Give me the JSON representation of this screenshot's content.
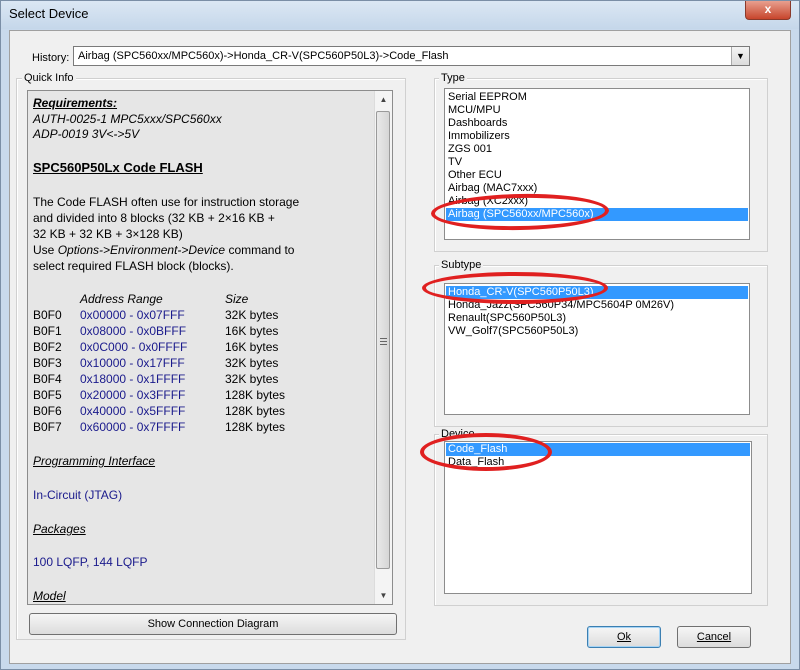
{
  "window": {
    "title": "Select Device",
    "close_label": "x"
  },
  "history": {
    "label": "History:",
    "value": "Airbag (SPC560xx/MPC560x)->Honda_CR-V(SPC560P50L3)->Code_Flash"
  },
  "quick_info": {
    "group_label": "Quick Info",
    "requirements_heading": "Requirements:",
    "req_line1": "AUTH-0025-1 MPC5xxx/SPC560xx",
    "req_line2": "ADP-0019 3V<->5V",
    "title": "SPC560P50Lx Code FLASH",
    "desc_line1": "The Code FLASH often use for instruction storage",
    "desc_line2": "and divided into 8 blocks (32 KB + 2×16 KB +",
    "desc_line3": "32 KB + 32 KB + 3×128 KB)",
    "desc_line4_pre": "Use ",
    "desc_line4_em": "Options->Environment->Device",
    "desc_line4_post": " command to",
    "desc_line5": "select required FLASH block (blocks).",
    "address_range_header": "Address Range",
    "size_header": "Size",
    "blocks": [
      {
        "name": "B0F0",
        "range": "0x00000 - 0x07FFF",
        "size": "32K bytes"
      },
      {
        "name": "B0F1",
        "range": "0x08000 - 0x0BFFF",
        "size": "16K bytes"
      },
      {
        "name": "B0F2",
        "range": "0x0C000 - 0x0FFFF",
        "size": "16K bytes"
      },
      {
        "name": "B0F3",
        "range": "0x10000 - 0x17FFF",
        "size": "32K bytes"
      },
      {
        "name": "B0F4",
        "range": "0x18000 - 0x1FFFF",
        "size": "32K bytes"
      },
      {
        "name": "B0F5",
        "range": "0x20000 - 0x3FFFF",
        "size": "128K bytes"
      },
      {
        "name": "B0F6",
        "range": "0x40000 - 0x5FFFF",
        "size": "128K bytes"
      },
      {
        "name": "B0F7",
        "range": "0x60000 - 0x7FFFF",
        "size": "128K bytes"
      }
    ],
    "programming_interface_heading": "Programming Interface",
    "programming_interface_value": "In-Circuit (JTAG)",
    "packages_heading": "Packages",
    "packages_value": "100 LQFP, 144 LQFP",
    "model_heading": "Model"
  },
  "show_connection_diagram_label": "Show Connection Diagram",
  "type": {
    "group_label": "Type",
    "items": [
      "Serial EEPROM",
      "MCU/MPU",
      "Dashboards",
      "Immobilizers",
      "ZGS 001",
      "TV",
      "Other ECU",
      "Airbag (MAC7xxx)",
      "Airbag (XC2xxx)",
      "Airbag (SPC560xx/MPC560x)"
    ],
    "selected_index": 9
  },
  "subtype": {
    "group_label": "Subtype",
    "items": [
      "Honda_CR-V(SPC560P50L3)",
      "Honda_Jazz(SPC560P34/MPC5604P 0M26V)",
      "Renault(SPC560P50L3)",
      "VW_Golf7(SPC560P50L3)"
    ],
    "selected_index": 0
  },
  "device": {
    "group_label": "Device",
    "items": [
      "Code_Flash",
      "Data_Flash"
    ],
    "selected_index": 0
  },
  "buttons": {
    "ok": "Ok",
    "cancel": "Cancel"
  },
  "colors": {
    "selection": "#3399ff",
    "annotation_ring": "#e02020",
    "link_blue": "#1a1a8c"
  }
}
